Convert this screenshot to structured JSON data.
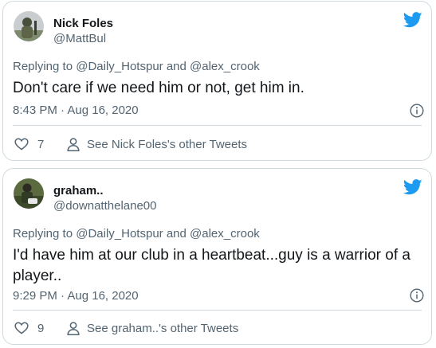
{
  "colors": {
    "twitter_blue": "#1d9bf0",
    "secondary_text": "#536471",
    "primary_text": "#14171a",
    "border": "#cfd9de"
  },
  "tweets": [
    {
      "display_name": "Nick Foles",
      "handle": "@MattBul",
      "reply_prefix": "Replying to",
      "reply_user1": "@Daily_Hotspur",
      "reply_and": "and",
      "reply_user2": "@alex_crook",
      "text": "Don't care if we need him or not, get him in.",
      "timestamp": "8:43 PM · Aug 16, 2020",
      "like_count": "7",
      "see_other": "See Nick Foles's other Tweets",
      "icons": {
        "brand": "twitter-bird-icon",
        "info": "info-icon",
        "like": "heart-icon",
        "profile": "person-icon"
      }
    },
    {
      "display_name": "graham..",
      "handle": "@downatthelane00",
      "reply_prefix": "Replying to",
      "reply_user1": "@Daily_Hotspur",
      "reply_and": "and",
      "reply_user2": "@alex_crook",
      "text": "I'd have him at our club in a heartbeat...guy is a warrior of a player..",
      "timestamp": "9:29 PM · Aug 16, 2020",
      "like_count": "9",
      "see_other": "See graham..'s other Tweets",
      "icons": {
        "brand": "twitter-bird-icon",
        "info": "info-icon",
        "like": "heart-icon",
        "profile": "person-icon"
      }
    }
  ]
}
